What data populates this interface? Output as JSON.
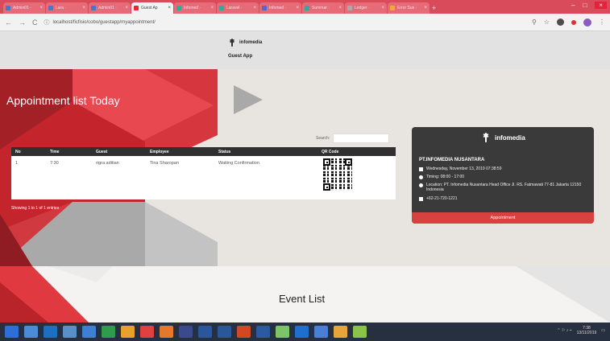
{
  "browser": {
    "tabs": [
      {
        "label": "Admin01 ·"
      },
      {
        "label": "Lara ·"
      },
      {
        "label": "Admin01 ·"
      },
      {
        "label": "Guest Ap"
      },
      {
        "label": "Infomed ·"
      },
      {
        "label": "Laravel ·"
      },
      {
        "label": "Infomed ·"
      },
      {
        "label": "Summar ·"
      },
      {
        "label": "Ledger ·"
      },
      {
        "label": "Error Sus ·"
      }
    ],
    "active_tab_index": 3,
    "url": "localhost/ficfisio/cobo/guestapp/myappointment/"
  },
  "app": {
    "logo_text": "infomedia",
    "title": "Guest App"
  },
  "appointments": {
    "heading": "Appointment list Today",
    "search_label": "Search:",
    "search_value": "",
    "columns": [
      "No",
      "Time",
      "Guest",
      "Employee",
      "Status",
      "QR Code"
    ],
    "rows": [
      {
        "no": "1",
        "time": "7:30",
        "guest": "rigra aditian",
        "employee": "Tina Sharopan",
        "status": "Waiting Confirmation"
      }
    ],
    "showing": "Showing 1 to 1 of 1 entries"
  },
  "company": {
    "logo_text": "infomedia",
    "name": "PT.INFOMEDIA NUSANTARA",
    "date": "Wednesday, November 13, 2019 07:38:59",
    "timing": "Timing: 08:00 - 17:00",
    "location": "Location: PT. Infomedia Nusantara Head Office Jl. RS. Fatmawati 77-81 Jakarta 12150 Indonesia",
    "phone": "+62-21-720-1221",
    "button_label": "Appointment"
  },
  "events": {
    "title": "Event List"
  },
  "taskbar": {
    "time": "7:38",
    "date": "13/11/2019"
  },
  "colors": {
    "tabbar": "#d94a5a",
    "accent_red": "#d94040",
    "card_bg": "#3a3a3a"
  }
}
